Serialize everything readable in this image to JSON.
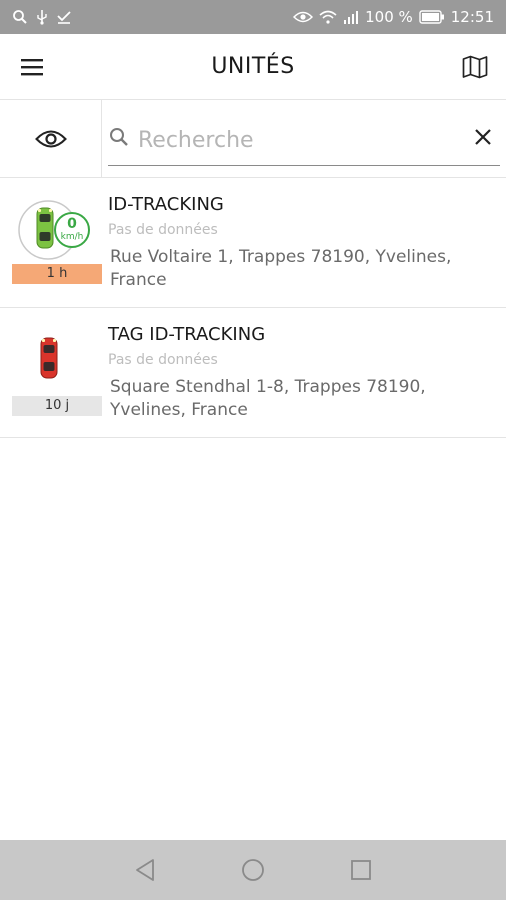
{
  "status_bar": {
    "battery": "100 %",
    "time": "12:51"
  },
  "app_bar": {
    "title": "UNITÉS"
  },
  "search": {
    "placeholder": "Recherche",
    "value": ""
  },
  "units": [
    {
      "name": "ID-TRACKING",
      "subtitle": "Pas de données",
      "address": "Rue Voltaire 1, Trappes 78190, Yvelines, France",
      "age": "1 h",
      "speed_value": "0",
      "speed_unit": "km/h",
      "vehicle_color": "#7cc242",
      "badge_color": "#f5a876"
    },
    {
      "name": "TAG ID-TRACKING",
      "subtitle": "Pas de données",
      "address": "Square Stendhal 1-8, Trappes 78190, Yvelines, France",
      "age": "10 j",
      "vehicle_color": "#d9342b",
      "badge_color": "#e6e6e6"
    }
  ],
  "icons": {
    "menu": "hamburger-icon",
    "map": "map-icon",
    "visibility": "eye-icon",
    "search": "search-icon",
    "clear": "close-icon",
    "nav_back": "triangle-back-icon",
    "nav_home": "circle-home-icon",
    "nav_recent": "square-recent-icon"
  },
  "colors": {
    "status_bar": "#9a9a9a",
    "nav_bar": "#c8c8c8",
    "speed_ring": "#3aa845"
  }
}
